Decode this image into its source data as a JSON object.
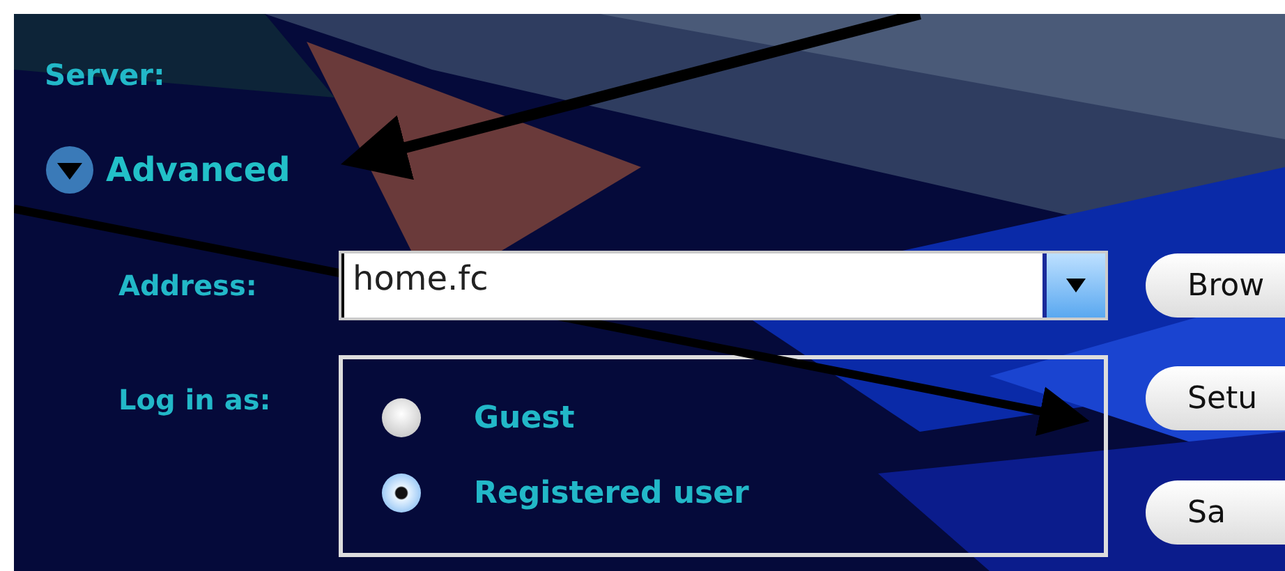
{
  "server_label": "Server:",
  "advanced": {
    "label": "Advanced",
    "expanded": true
  },
  "address": {
    "label": "Address:",
    "value": "home.fc"
  },
  "login": {
    "label": "Log in as:",
    "options": [
      {
        "label": "Guest",
        "selected": false
      },
      {
        "label": "Registered user",
        "selected": true
      }
    ]
  },
  "buttons": [
    "Brow",
    "Setu",
    "Sa"
  ]
}
